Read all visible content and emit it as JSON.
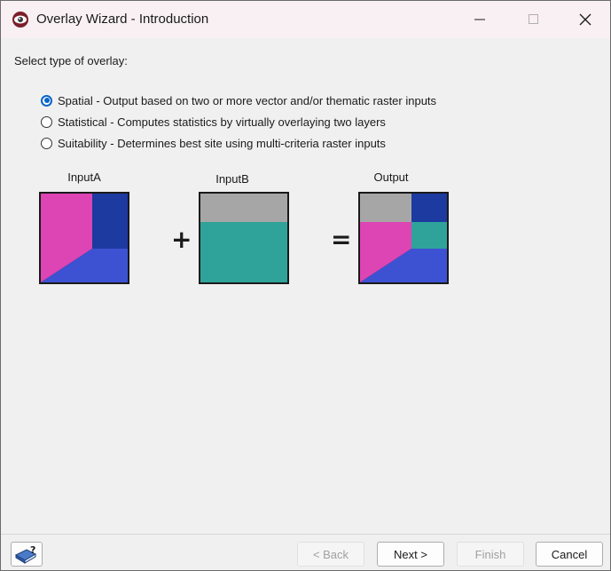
{
  "window": {
    "title": "Overlay Wizard - Introduction",
    "controls": {
      "minimize": "minimize",
      "maximize": "maximize",
      "close": "close"
    }
  },
  "prompt": "Select type of overlay:",
  "options": [
    {
      "label": "Spatial - Output based on two or more vector and/or thematic raster inputs",
      "checked": true
    },
    {
      "label": "Statistical - Computes statistics by virtually overlaying two layers",
      "checked": false
    },
    {
      "label": "Suitability - Determines best site using multi-criteria raster inputs",
      "checked": false
    }
  ],
  "diagram": {
    "input_a_label": "InputA",
    "input_b_label": "InputB",
    "output_label": "Output",
    "plus": "+",
    "equals": "=",
    "colors": {
      "magenta": "#dd44b4",
      "navy": "#1c3aa0",
      "blue": "#3c52d2",
      "gray": "#a6a6a6",
      "teal": "#2fa39a"
    }
  },
  "footer": {
    "back": "< Back",
    "next": "Next >",
    "finish": "Finish",
    "cancel": "Cancel"
  },
  "icons": {
    "app": "eye-icon",
    "help": "book-question-icon"
  }
}
